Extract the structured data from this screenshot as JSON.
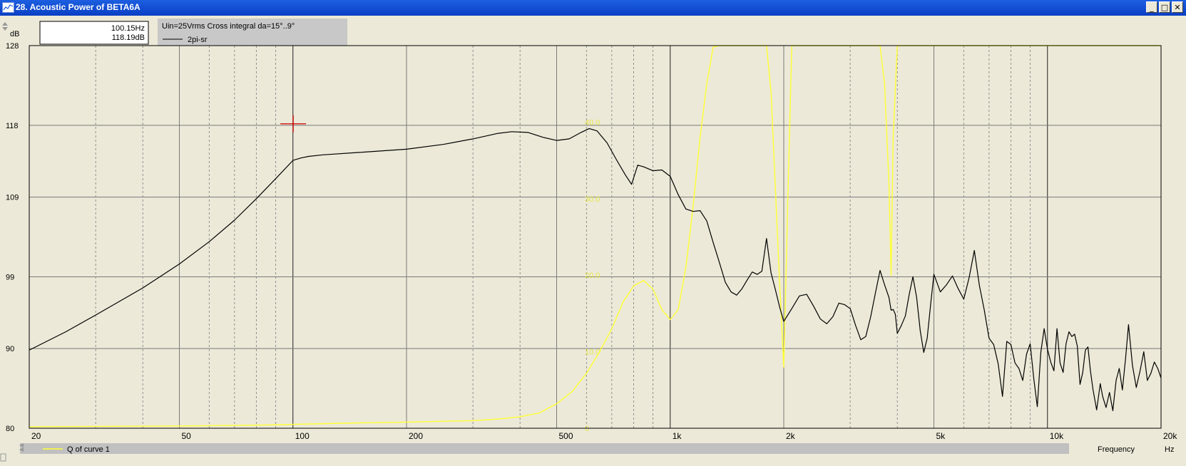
{
  "window": {
    "title": "28. Acoustic Power of BETA6A",
    "buttons": {
      "minimize": "_",
      "maximize": "□",
      "close": "✕"
    }
  },
  "readout": {
    "freq": "100.15Hz",
    "level": "118.19dB"
  },
  "legend": {
    "header": "Uin=25Vrms Cross integral da=15°..9°",
    "series1": "2pi-sr",
    "series2": "Q of curve 1"
  },
  "colors": {
    "background": "#ECE9D8",
    "curve1": "#000000",
    "curve2": "#FFFF33",
    "grid": "#808080",
    "cursor": "#CC0000",
    "titlebar": "#0A3FC4"
  },
  "chart_data": {
    "type": "line",
    "x_scale": "log",
    "xlim": [
      20,
      20000
    ],
    "ylim": [
      80,
      128
    ],
    "ylabel": "dB",
    "xlabel": "Frequency",
    "x_unit": "Hz",
    "x_ticks": [
      20,
      50,
      100,
      200,
      500,
      1000,
      2000,
      5000,
      10000,
      20000
    ],
    "x_tick_labels": [
      "20",
      "50",
      "100",
      "200",
      "500",
      "1k",
      "2k",
      "5k",
      "10k",
      "20k"
    ],
    "y_ticks": [
      80,
      90,
      99,
      109,
      118,
      128
    ],
    "y_tick_labels": [
      "80",
      "90",
      "99",
      "109",
      "118",
      "128"
    ],
    "y2lim": [
      0,
      50
    ],
    "y2_ticks": [
      0,
      10,
      20,
      30,
      40
    ],
    "y2_tick_labels": [
      "0",
      "10.0",
      "20.0",
      "30.0",
      "40.0"
    ],
    "cursor": {
      "x": 100.15,
      "y": 118.19
    },
    "series": [
      {
        "name": "2pi-sr",
        "axis": "left",
        "color": "#000000",
        "points": [
          [
            20,
            89.8
          ],
          [
            25,
            92.1
          ],
          [
            30,
            94.2
          ],
          [
            40,
            97.6
          ],
          [
            50,
            100.6
          ],
          [
            60,
            103.4
          ],
          [
            70,
            106.1
          ],
          [
            80,
            108.8
          ],
          [
            90,
            111.3
          ],
          [
            100,
            113.6
          ],
          [
            105,
            113.9
          ],
          [
            110,
            114.1
          ],
          [
            120,
            114.3
          ],
          [
            150,
            114.6
          ],
          [
            200,
            115.0
          ],
          [
            250,
            115.6
          ],
          [
            300,
            116.3
          ],
          [
            350,
            117.0
          ],
          [
            380,
            117.2
          ],
          [
            420,
            117.1
          ],
          [
            460,
            116.5
          ],
          [
            500,
            116.1
          ],
          [
            540,
            116.3
          ],
          [
            580,
            117.1
          ],
          [
            610,
            117.6
          ],
          [
            640,
            117.3
          ],
          [
            680,
            115.8
          ],
          [
            720,
            113.7
          ],
          [
            760,
            111.8
          ],
          [
            790,
            110.6
          ],
          [
            820,
            113.0
          ],
          [
            850,
            112.8
          ],
          [
            900,
            112.3
          ],
          [
            950,
            112.4
          ],
          [
            1000,
            111.6
          ],
          [
            1050,
            109.3
          ],
          [
            1100,
            107.5
          ],
          [
            1150,
            107.2
          ],
          [
            1200,
            107.3
          ],
          [
            1250,
            106.0
          ],
          [
            1300,
            103.3
          ],
          [
            1350,
            100.8
          ],
          [
            1400,
            98.3
          ],
          [
            1450,
            97.1
          ],
          [
            1500,
            96.7
          ],
          [
            1550,
            97.5
          ],
          [
            1600,
            98.6
          ],
          [
            1650,
            99.6
          ],
          [
            1700,
            99.3
          ],
          [
            1750,
            99.7
          ],
          [
            1800,
            103.8
          ],
          [
            1850,
            99.5
          ],
          [
            1900,
            97.4
          ],
          [
            1950,
            95.2
          ],
          [
            2000,
            93.4
          ],
          [
            2100,
            95.0
          ],
          [
            2200,
            96.6
          ],
          [
            2300,
            96.8
          ],
          [
            2400,
            95.3
          ],
          [
            2500,
            93.7
          ],
          [
            2600,
            93.1
          ],
          [
            2700,
            94.0
          ],
          [
            2800,
            95.7
          ],
          [
            2900,
            95.5
          ],
          [
            3000,
            95.0
          ],
          [
            3100,
            92.9
          ],
          [
            3200,
            91.1
          ],
          [
            3300,
            91.5
          ],
          [
            3400,
            94.0
          ],
          [
            3500,
            97.0
          ],
          [
            3600,
            99.8
          ],
          [
            3700,
            98.0
          ],
          [
            3800,
            96.4
          ],
          [
            3850,
            94.8
          ],
          [
            3900,
            94.9
          ],
          [
            3950,
            94.3
          ],
          [
            4000,
            91.9
          ],
          [
            4100,
            92.9
          ],
          [
            4200,
            94.1
          ],
          [
            4300,
            96.8
          ],
          [
            4400,
            99.0
          ],
          [
            4500,
            96.4
          ],
          [
            4600,
            92.2
          ],
          [
            4700,
            89.5
          ],
          [
            4800,
            91.3
          ],
          [
            4900,
            95.5
          ],
          [
            5000,
            99.3
          ],
          [
            5100,
            98.2
          ],
          [
            5200,
            97.1
          ],
          [
            5400,
            98.0
          ],
          [
            5600,
            99.1
          ],
          [
            5800,
            97.5
          ],
          [
            6000,
            96.2
          ],
          [
            6200,
            98.9
          ],
          [
            6400,
            102.3
          ],
          [
            6600,
            97.9
          ],
          [
            6800,
            94.8
          ],
          [
            7000,
            91.3
          ],
          [
            7200,
            90.5
          ],
          [
            7400,
            88.1
          ],
          [
            7600,
            84.0
          ],
          [
            7800,
            90.9
          ],
          [
            8000,
            90.5
          ],
          [
            8200,
            88.2
          ],
          [
            8400,
            87.5
          ],
          [
            8600,
            86.0
          ],
          [
            8800,
            89.3
          ],
          [
            9000,
            90.6
          ],
          [
            9200,
            86.2
          ],
          [
            9400,
            82.7
          ],
          [
            9600,
            89.5
          ],
          [
            9800,
            92.5
          ],
          [
            10000,
            89.9
          ],
          [
            10200,
            88.3
          ],
          [
            10400,
            87.2
          ],
          [
            10600,
            92.5
          ],
          [
            10800,
            88.2
          ],
          [
            11000,
            87.0
          ],
          [
            11200,
            90.6
          ],
          [
            11400,
            92.1
          ],
          [
            11600,
            91.5
          ],
          [
            11800,
            91.8
          ],
          [
            12000,
            90.3
          ],
          [
            12200,
            85.5
          ],
          [
            12400,
            87.0
          ],
          [
            12600,
            89.8
          ],
          [
            12800,
            90.2
          ],
          [
            13000,
            87.2
          ],
          [
            13200,
            84.9
          ],
          [
            13500,
            82.3
          ],
          [
            13800,
            85.6
          ],
          [
            14000,
            84.0
          ],
          [
            14300,
            82.6
          ],
          [
            14600,
            84.5
          ],
          [
            14900,
            82.2
          ],
          [
            15200,
            86.0
          ],
          [
            15500,
            87.5
          ],
          [
            15800,
            84.8
          ],
          [
            16100,
            88.7
          ],
          [
            16400,
            93.0
          ],
          [
            16800,
            87.9
          ],
          [
            17200,
            85.1
          ],
          [
            17600,
            87.2
          ],
          [
            18000,
            89.6
          ],
          [
            18400,
            86.0
          ],
          [
            18800,
            86.9
          ],
          [
            19200,
            88.3
          ],
          [
            19600,
            87.5
          ],
          [
            20000,
            86.3
          ]
        ]
      },
      {
        "name": "Q of curve 1",
        "axis": "right",
        "color": "#FFFF33",
        "points": [
          [
            20,
            0.2
          ],
          [
            50,
            0.3
          ],
          [
            80,
            0.4
          ],
          [
            100,
            0.5
          ],
          [
            150,
            0.7
          ],
          [
            200,
            0.8
          ],
          [
            300,
            1.0
          ],
          [
            350,
            1.2
          ],
          [
            400,
            1.5
          ],
          [
            450,
            2.0
          ],
          [
            500,
            3.2
          ],
          [
            550,
            4.8
          ],
          [
            600,
            7.2
          ],
          [
            650,
            10.0
          ],
          [
            700,
            13.0
          ],
          [
            750,
            16.5
          ],
          [
            800,
            18.6
          ],
          [
            850,
            19.3
          ],
          [
            900,
            18.2
          ],
          [
            950,
            15.5
          ],
          [
            1000,
            14.2
          ],
          [
            1050,
            15.5
          ],
          [
            1100,
            21.0
          ],
          [
            1150,
            29.0
          ],
          [
            1200,
            38.0
          ],
          [
            1250,
            45.0
          ],
          [
            1300,
            49.8
          ],
          [
            1350,
            50.0
          ],
          [
            1700,
            50.0
          ],
          [
            1800,
            50.0
          ],
          [
            1850,
            44.0
          ],
          [
            1950,
            19.0
          ],
          [
            2000,
            8.0
          ],
          [
            2050,
            30.0
          ],
          [
            2100,
            50.0
          ],
          [
            3500,
            50.0
          ],
          [
            3600,
            50.0
          ],
          [
            3700,
            45.0
          ],
          [
            3800,
            32.0
          ],
          [
            3850,
            20.0
          ],
          [
            3900,
            38.0
          ],
          [
            4000,
            50.0
          ],
          [
            20000,
            50.0
          ]
        ]
      }
    ]
  }
}
